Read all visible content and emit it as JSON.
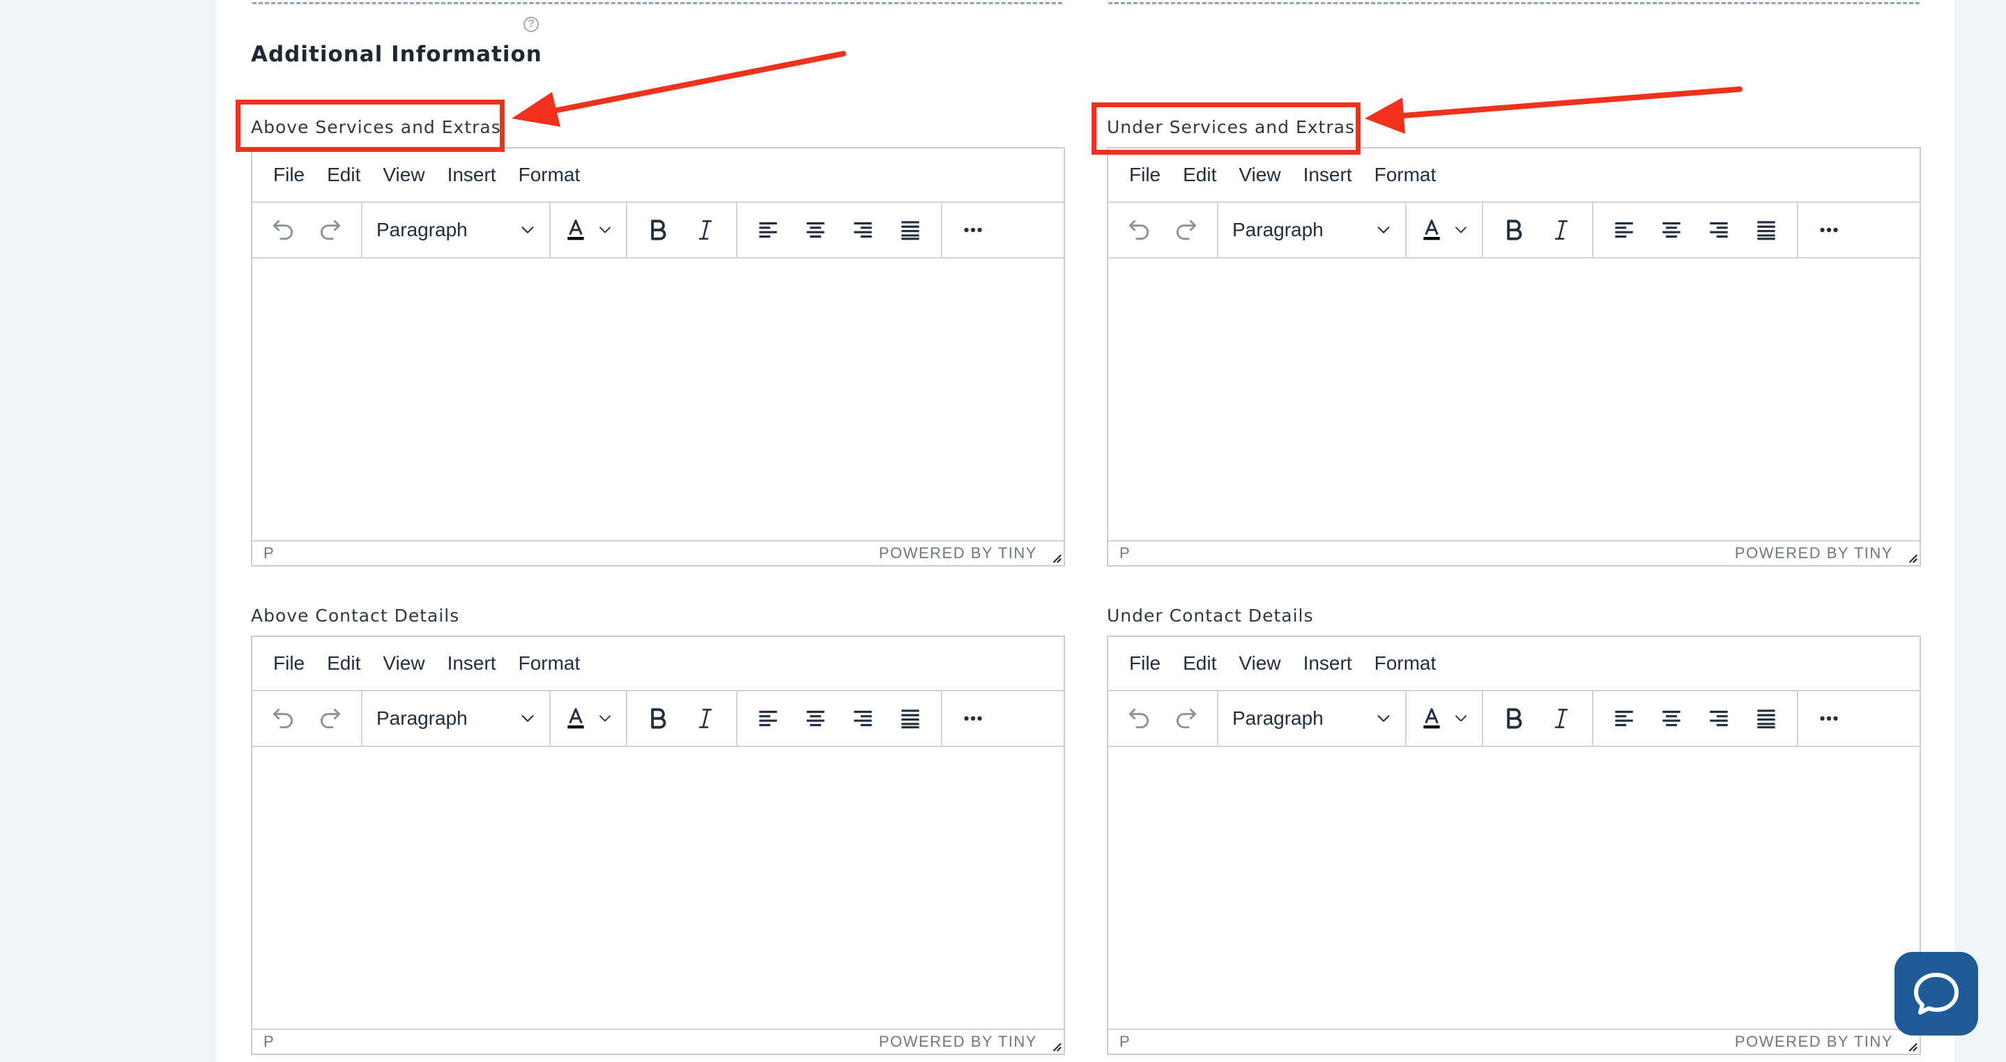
{
  "section": {
    "title": "Additional Information"
  },
  "editors": [
    {
      "label": "Above Services and Extras",
      "highlighted": true
    },
    {
      "label": "Under Services and Extras",
      "highlighted": true
    },
    {
      "label": "Above Contact Details",
      "highlighted": false
    },
    {
      "label": "Under Contact Details",
      "highlighted": false
    }
  ],
  "editor_common": {
    "menus": [
      "File",
      "Edit",
      "View",
      "Insert",
      "Format"
    ],
    "block_format": "Paragraph",
    "toolbar_icons": [
      "undo-icon",
      "redo-icon",
      "text-color-icon",
      "bold-icon",
      "italic-icon",
      "align-left-icon",
      "align-center-icon",
      "align-right-icon",
      "justify-icon",
      "more-icon"
    ],
    "status_path": "P",
    "branding": "POWERED BY TINY"
  },
  "annotation": {
    "color": "#f0321c"
  },
  "colors": {
    "chat_button": "#1e5b97",
    "background": "#f1f5f8"
  },
  "chat": {
    "icon": "chat-bubble-icon"
  }
}
